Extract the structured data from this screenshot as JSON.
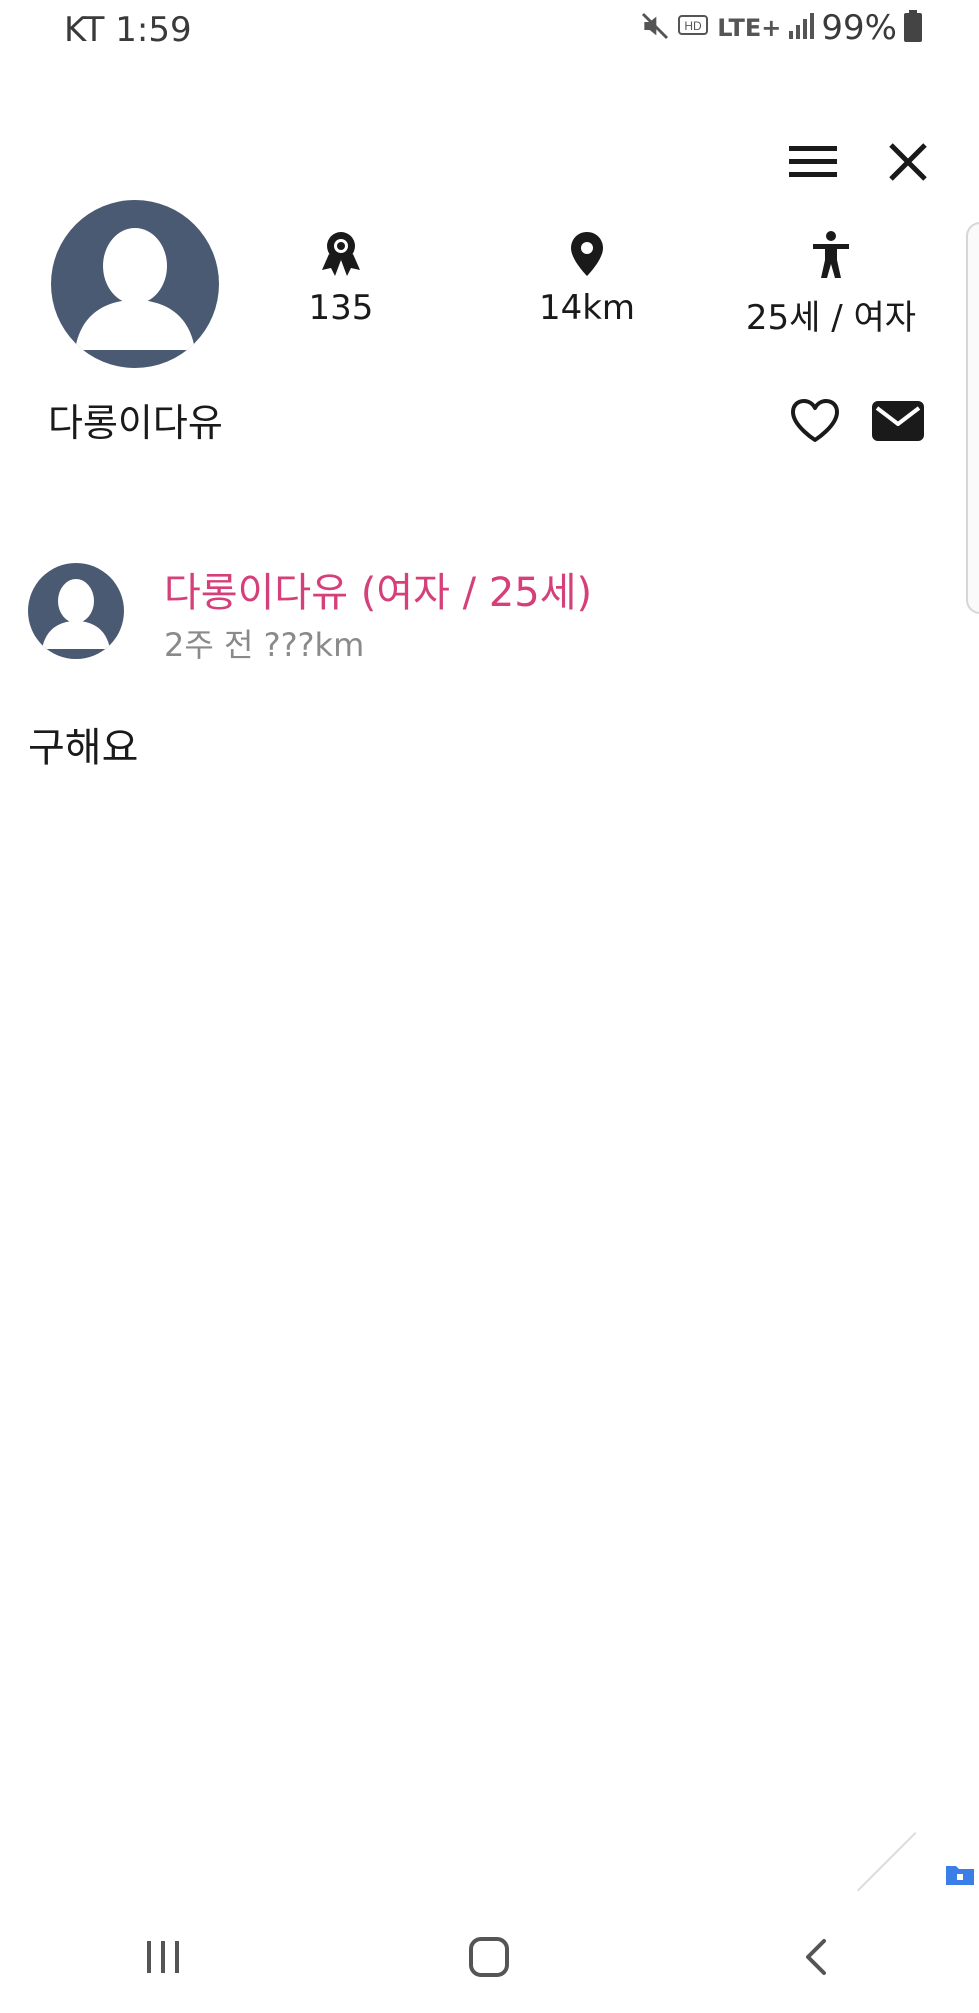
{
  "status_bar": {
    "carrier_time": "KT 1:59",
    "battery": "99%",
    "network": "LTE+",
    "hd_label": "HD",
    "icons": [
      "mute-icon",
      "hd-icon",
      "lte-icon",
      "signal-icon",
      "battery-icon"
    ]
  },
  "header": {
    "icons": [
      "menu-icon",
      "close-icon"
    ]
  },
  "profile": {
    "name": "다롱이다유",
    "stats": {
      "points": "135",
      "distance": "14km",
      "age_gender": "25세 / 여자"
    },
    "stat_icons": [
      "award-icon",
      "location-pin-icon",
      "person-icon"
    ],
    "action_icons": [
      "heart-icon",
      "mail-icon"
    ]
  },
  "post": {
    "author": "다롱이다유 (여자 / 25세)",
    "meta": "2주 전  ???km",
    "body": "구해요"
  },
  "nav_bar": {
    "icons": [
      "recent-apps-icon",
      "home-icon",
      "back-icon"
    ]
  },
  "colors": {
    "accent": "#d6407a",
    "avatar": "#4a5a73",
    "meta_text": "#8a8a8a",
    "badge": "#3b7ee8"
  }
}
